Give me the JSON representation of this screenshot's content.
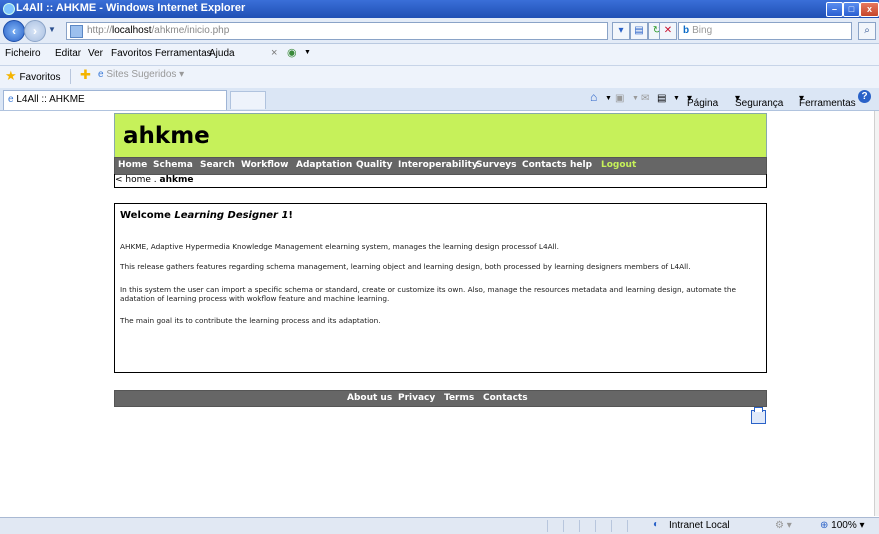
{
  "window": {
    "title": "L4All :: AHKME - Windows Internet Explorer"
  },
  "addressbar": {
    "url_prefix": "http://",
    "url_host": "localhost",
    "url_path": "/ahkme/inicio.php",
    "search_placeholder": "Bing"
  },
  "menubar": {
    "items": [
      "Ficheiro",
      "Editar",
      "Ver",
      "Favoritos",
      "Ferramentas",
      "Ajuda"
    ]
  },
  "favbar": {
    "favorites_label": "Favoritos",
    "suggested_sites_label": "Sites Sugeridos"
  },
  "tabs": [
    {
      "label": "L4All :: AHKME"
    }
  ],
  "commandbar": {
    "page_label": "Página",
    "security_label": "Segurança",
    "tools_label": "Ferramentas"
  },
  "site": {
    "logo": "ahkme",
    "nav": [
      "Home",
      "Schema",
      "Search",
      "Workflow",
      "Adaptation",
      "Quality",
      "Interoperability",
      "Surveys",
      "Contacts",
      "help",
      "Logout"
    ],
    "breadcrumb": {
      "prefix": "< home .",
      "current": "ahkme"
    },
    "welcome": {
      "prefix": "Welcome ",
      "user": "Learning Designer 1",
      "suffix": "!"
    },
    "paragraphs": [
      "AHKME, Adaptive Hypermedia Knowledge Management elearning system, manages the learning design processof L4All.",
      "This release gathers features regarding schema management, learning object and learning design, both processed by learning designers members of L4All.",
      "In this system the user can import a specific schema or standard, create or customize its own. Also, manage the resources metadata and learning design, automate the adatation of learning process with wokflow feature and machine learning.",
      "The main goal its to contribute the learning process and its adaptation."
    ],
    "footer_links": [
      "About us",
      "Privacy",
      "Terms",
      "Contacts"
    ]
  },
  "statusbar": {
    "zone": "Intranet Local",
    "zoom": "100%"
  },
  "colors": {
    "banner": "#c6f15a",
    "nav_bg": "#666666",
    "logout": "#c6f15a",
    "titlebar": "#1f4fb4"
  }
}
